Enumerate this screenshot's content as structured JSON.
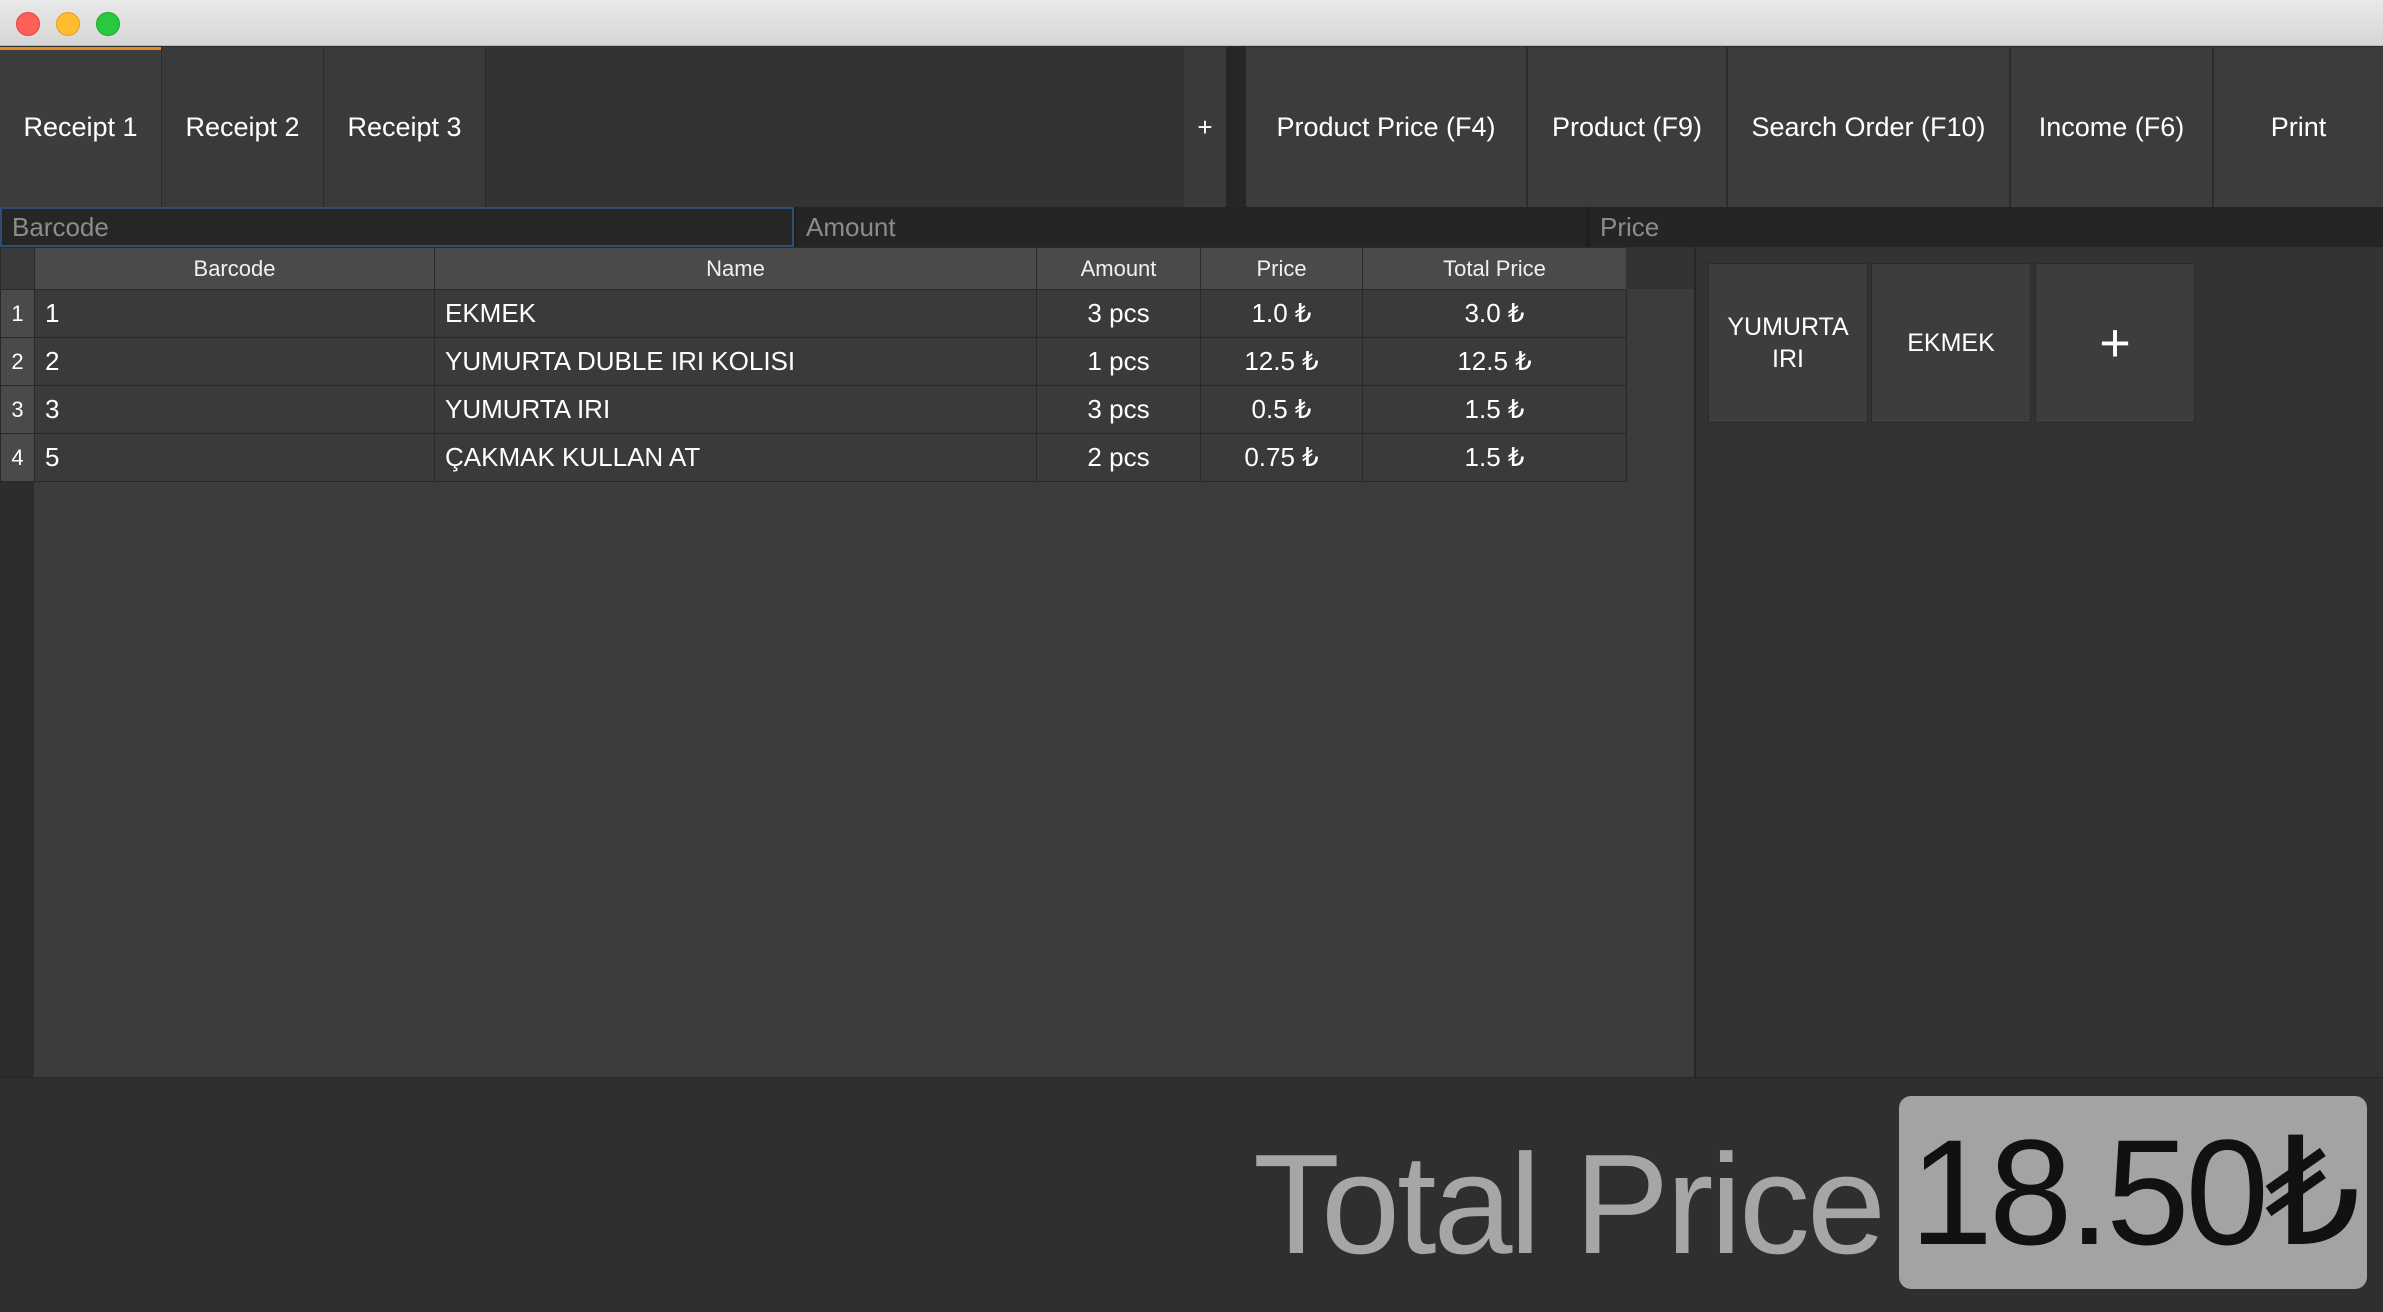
{
  "window": {
    "controls": [
      "close",
      "minimize",
      "maximize"
    ]
  },
  "tabs": [
    {
      "label": "Receipt 1",
      "active": true
    },
    {
      "label": "Receipt 2",
      "active": false
    },
    {
      "label": "Receipt 3",
      "active": false
    }
  ],
  "add_tab_label": "+",
  "actions": {
    "product_price": "Product Price (F4)",
    "product": "Product (F9)",
    "search_order": "Search Order (F10)",
    "income": "Income (F6)",
    "print": "Print"
  },
  "inputs": {
    "barcode_placeholder": "Barcode",
    "amount_placeholder": "Amount",
    "price_placeholder": "Price"
  },
  "table": {
    "columns": [
      "Barcode",
      "Name",
      "Amount",
      "Price",
      "Total Price"
    ],
    "rows": [
      {
        "num": "1",
        "barcode": "1",
        "name": "EKMEK",
        "amount": "3 pcs",
        "price": "1.0 ₺",
        "total": "3.0 ₺"
      },
      {
        "num": "2",
        "barcode": "2",
        "name": "YUMURTA DUBLE IRI KOLISI",
        "amount": "1 pcs",
        "price": "12.5 ₺",
        "total": "12.5 ₺"
      },
      {
        "num": "3",
        "barcode": "3",
        "name": "YUMURTA IRI",
        "amount": "3 pcs",
        "price": "0.5 ₺",
        "total": "1.5 ₺"
      },
      {
        "num": "4",
        "barcode": "5",
        "name": "ÇAKMAK KULLAN AT",
        "amount": "2 pcs",
        "price": "0.75 ₺",
        "total": "1.5 ₺"
      }
    ]
  },
  "quick_products": {
    "items": [
      "YUMURTA IRI",
      "EKMEK"
    ],
    "add_label": "+"
  },
  "total": {
    "label": "Total Price",
    "value": "18.50₺"
  },
  "colors": {
    "accent_tab": "#e8862a",
    "focus_border": "#2e4f73",
    "total_box": "#a3a3a3"
  }
}
